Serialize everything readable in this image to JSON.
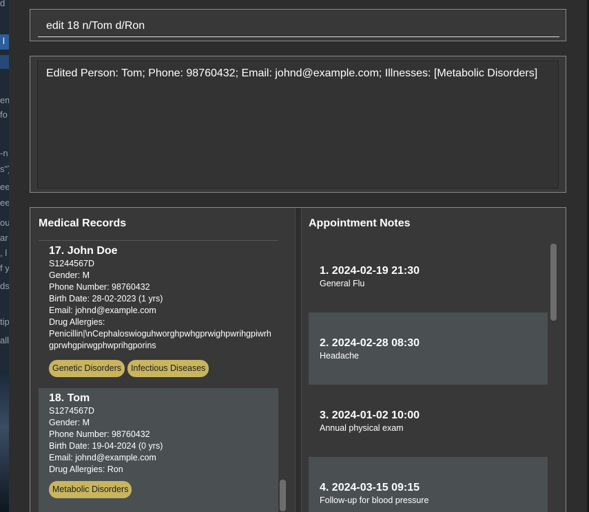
{
  "background_window": {
    "fragments": [
      "d",
      "l",
      "em",
      "fo",
      "-n",
      "s\")",
      "ee",
      "ee",
      "ou",
      "ar",
      ", l",
      "f y",
      "ds",
      "tip",
      "all"
    ]
  },
  "command_box": {
    "value": "edit 18 n/Tom d/Ron"
  },
  "result_display": {
    "text": "Edited Person: Tom; Phone: 98760432; Email: johnd@example.com; Illnesses: [Metabolic Disorders]"
  },
  "medical_records": {
    "title": "Medical Records",
    "records": [
      {
        "heading": "17.  John Doe",
        "lines": [
          "S1244567D",
          "Gender: M",
          "Phone Number: 98760432",
          "Birth Date: 28-02-2023 (1 yrs)",
          "Email: johnd@example.com",
          "Drug Allergies:",
          "Penicillin|\\nCephaloswioguhworghpwhgprwighpwrihgpiwrh",
          "gprwhgpirwgphwprihgporins"
        ],
        "tags": [
          "Genetic Disorders",
          "Infectious Diseases"
        ]
      },
      {
        "heading": "18.  Tom",
        "lines": [
          "S1274567D",
          "Gender: M",
          "Phone Number: 98760432",
          "Birth Date: 19-04-2024 (0 yrs)",
          "Email: johnd@example.com",
          "Drug Allergies: Ron"
        ],
        "tags": [
          "Metabolic Disorders"
        ]
      }
    ]
  },
  "appointment_notes": {
    "title": "Appointment Notes",
    "notes": [
      {
        "heading": "1.  2024-02-19 21:30",
        "desc": "General Flu"
      },
      {
        "heading": "2.  2024-02-28 08:30",
        "desc": "Headache"
      },
      {
        "heading": "3.  2024-01-02 10:00",
        "desc": "Annual physical exam"
      },
      {
        "heading": "4.  2024-03-15 09:15",
        "desc": "Follow-up for blood pressure"
      }
    ]
  },
  "colors": {
    "tag_bg": "#c9b55e",
    "row_alt": "#4a4f52",
    "row_dark": "#383838"
  }
}
